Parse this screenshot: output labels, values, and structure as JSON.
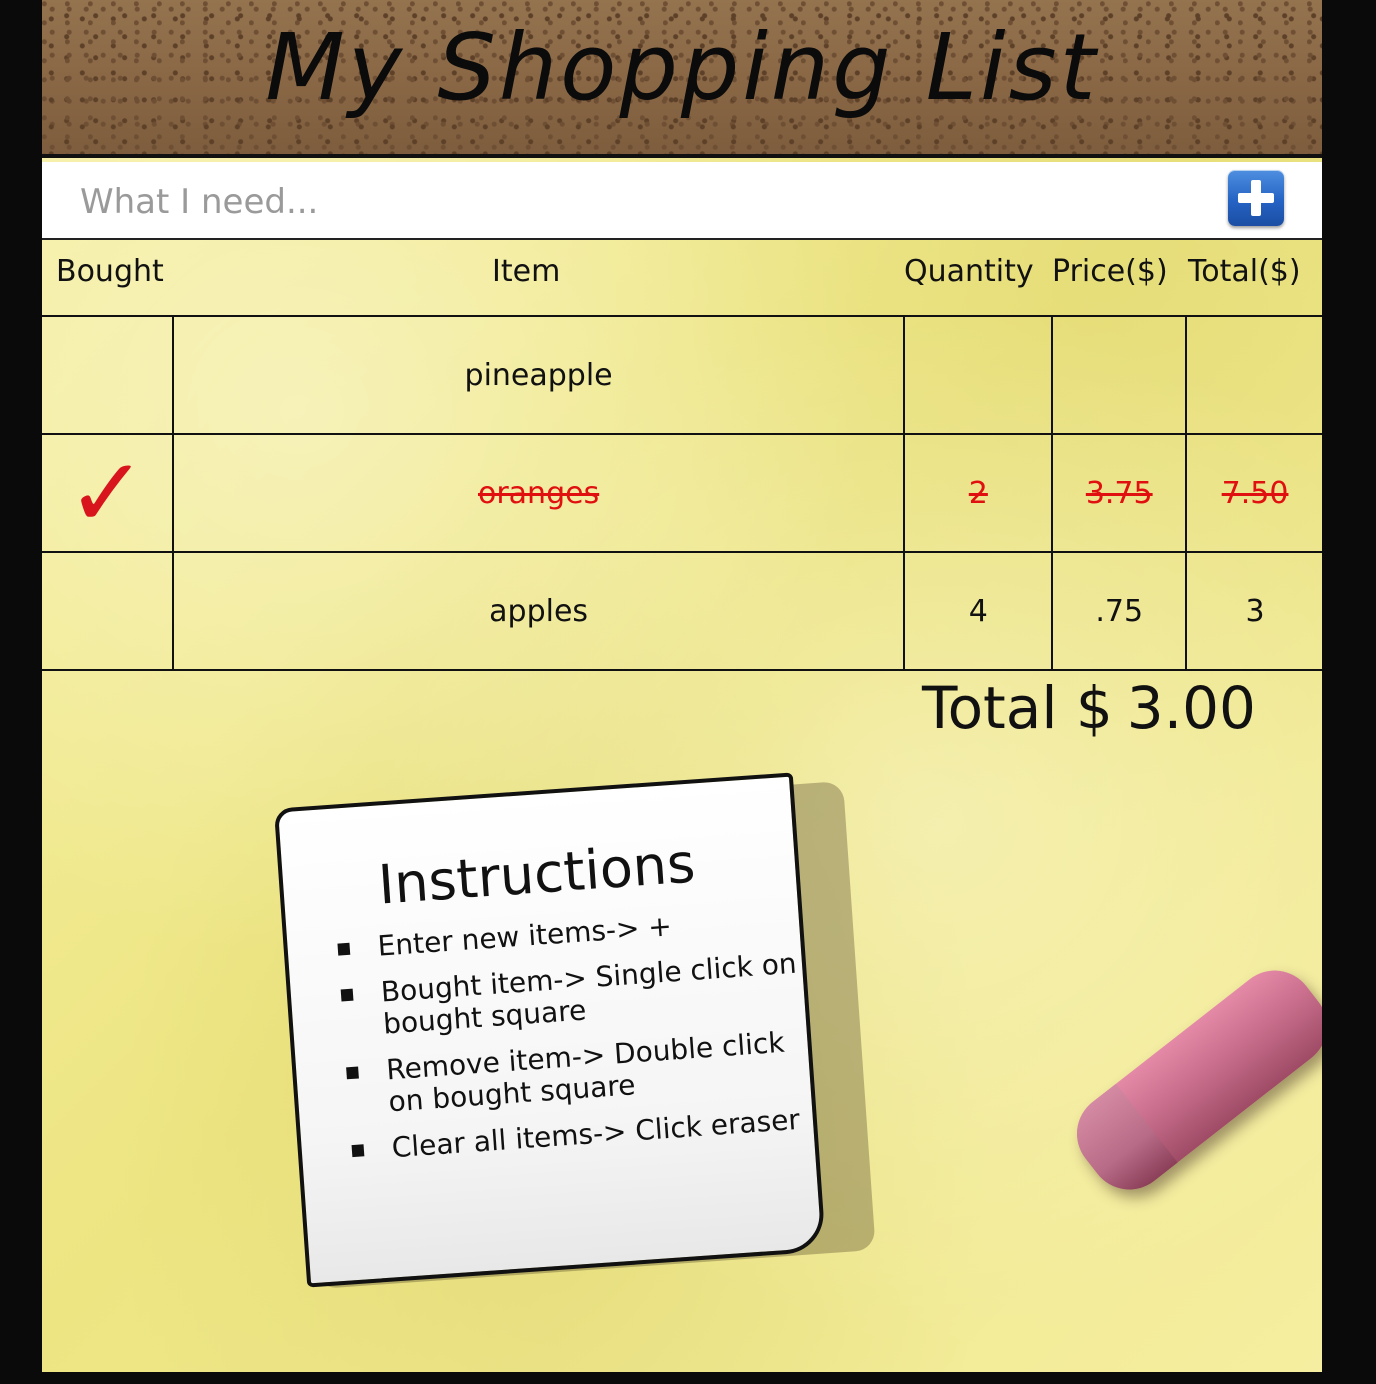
{
  "header": {
    "title": "My Shopping List"
  },
  "entry": {
    "placeholder": "What I need...",
    "add_icon": "plus-icon"
  },
  "columns": {
    "bought": "Bought",
    "item": "Item",
    "quantity": "Quantity",
    "price": "Price($)",
    "total": "Total($)"
  },
  "items": [
    {
      "name": "pineapple",
      "quantity": "",
      "price": "",
      "total": "",
      "bought": false
    },
    {
      "name": "oranges",
      "quantity": "2",
      "price": "3.75",
      "total": "7.50",
      "bought": true,
      "check": "✓"
    },
    {
      "name": "apples",
      "quantity": "4",
      "price": ".75",
      "total": "3",
      "bought": false
    }
  ],
  "summary": {
    "label": "Total $",
    "value": "3.00"
  },
  "instructions": {
    "title": "Instructions",
    "steps": [
      "Enter new items-> +",
      "Bought item-> Single click on bought square",
      "Remove item-> Double click on bought square",
      "Clear all items-> Click eraser"
    ]
  },
  "colors": {
    "bought": "#e01010",
    "paper": "#f3ec93",
    "cork": "#8b6a4a"
  }
}
